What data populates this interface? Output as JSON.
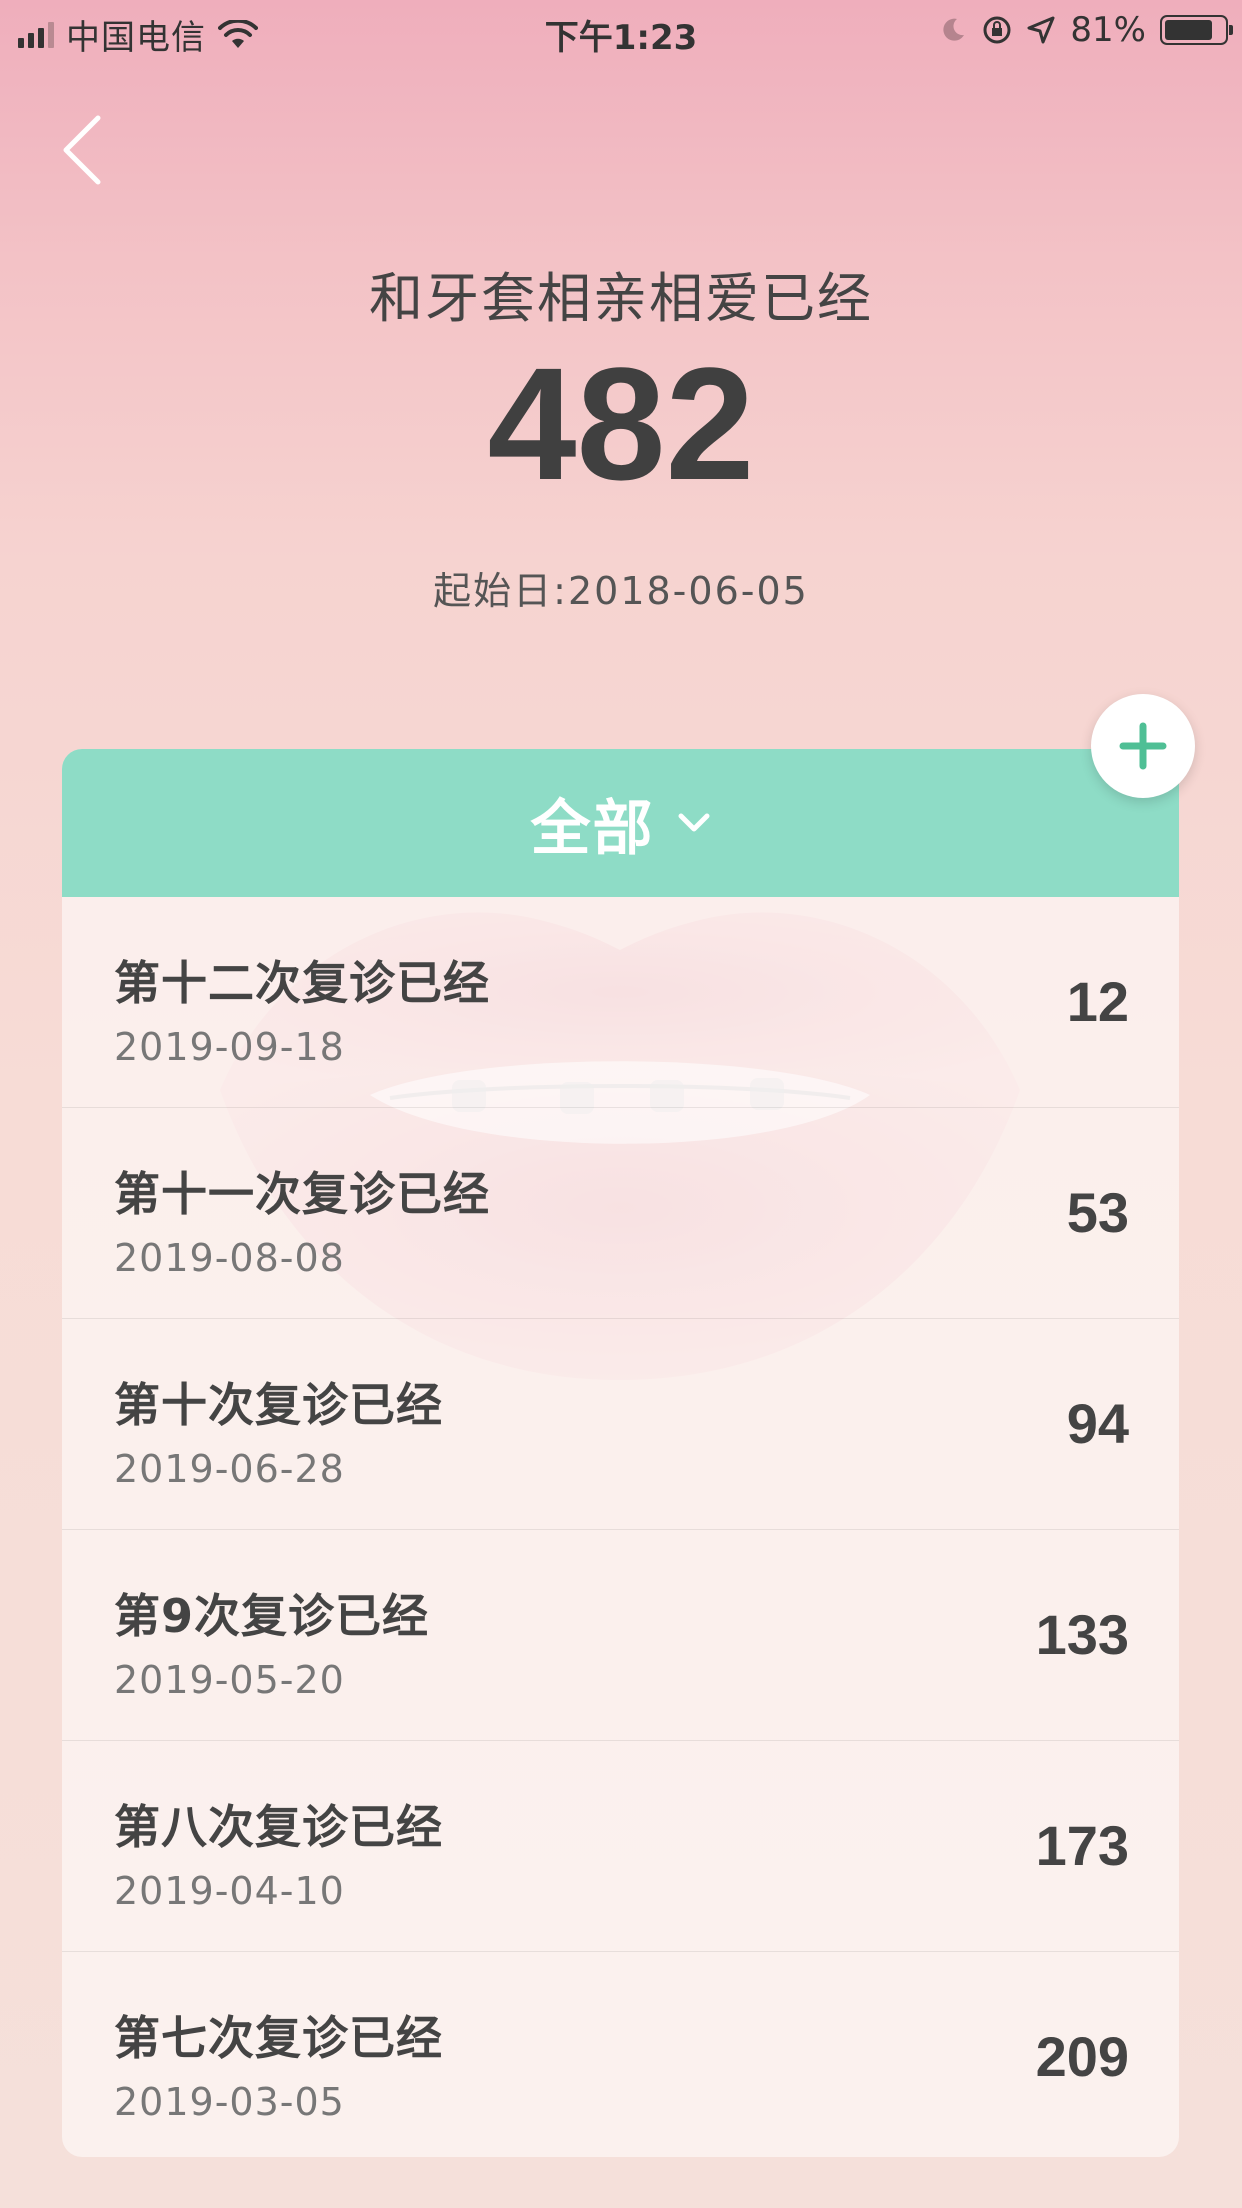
{
  "status_bar": {
    "carrier": "中国电信",
    "time": "下午1:23",
    "battery": "81%",
    "battery_level": 0.81
  },
  "header": {
    "subtitle": "和牙套相亲相爱已经",
    "day_count": "482",
    "start_date": "起始日:2018-06-05"
  },
  "filter": {
    "label": "全部"
  },
  "records": [
    {
      "title": "第十二次复诊已经",
      "date": "2019-09-18",
      "value": "12"
    },
    {
      "title": "第十一次复诊已经",
      "date": "2019-08-08",
      "value": "53"
    },
    {
      "title": "第十次复诊已经",
      "date": "2019-06-28",
      "value": "94"
    },
    {
      "title": "第9次复诊已经",
      "date": "2019-05-20",
      "value": "133"
    },
    {
      "title": "第八次复诊已经",
      "date": "2019-04-10",
      "value": "173"
    },
    {
      "title": "第七次复诊已经",
      "date": "2019-03-05",
      "value": "209"
    }
  ],
  "colors": {
    "accent": "#8edcc6",
    "plus": "#4fbf95"
  },
  "icons": {
    "back": "chevron-left-icon",
    "add": "plus-icon",
    "filter": "chevron-down-icon"
  }
}
